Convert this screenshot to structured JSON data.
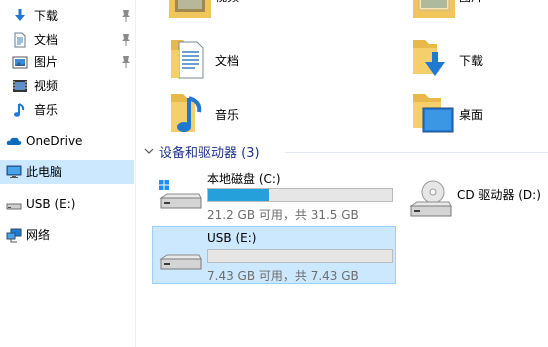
{
  "sidebar": {
    "items": [
      {
        "label": "下载",
        "pinned": true
      },
      {
        "label": "文档",
        "pinned": true
      },
      {
        "label": "图片",
        "pinned": true
      },
      {
        "label": "视频",
        "pinned": false
      },
      {
        "label": "音乐",
        "pinned": false
      },
      {
        "label": "OneDrive"
      },
      {
        "label": "此电脑",
        "selected": true
      },
      {
        "label": "USB (E:)"
      },
      {
        "label": "网络"
      }
    ]
  },
  "folders": [
    {
      "label": "视频",
      "icon": "video-folder-icon"
    },
    {
      "label": "图片",
      "icon": "pictures-folder-icon"
    },
    {
      "label": "文档",
      "icon": "documents-folder-icon"
    },
    {
      "label": "下载",
      "icon": "downloads-folder-icon"
    },
    {
      "label": "音乐",
      "icon": "music-folder-icon"
    },
    {
      "label": "桌面",
      "icon": "desktop-folder-icon"
    }
  ],
  "devices_group": {
    "label": "设备和驱动器 (3)"
  },
  "drives": [
    {
      "name": "本地磁盘 (C:)",
      "free_text": "21.2 GB 可用，共 31.5 GB",
      "used_fraction": 0.33,
      "icon": "windows-drive-icon"
    },
    {
      "name": "CD 驱动器 (D:)",
      "icon": "cd-drive-icon"
    },
    {
      "name": "USB (E:)",
      "free_text": "7.43 GB 可用，共 7.43 GB",
      "used_fraction": 0.0,
      "selected": true,
      "icon": "usb-drive-icon"
    }
  ],
  "colors": {
    "accent": "#26a0da",
    "selection": "#cce8ff",
    "group_header": "#1e3287"
  }
}
